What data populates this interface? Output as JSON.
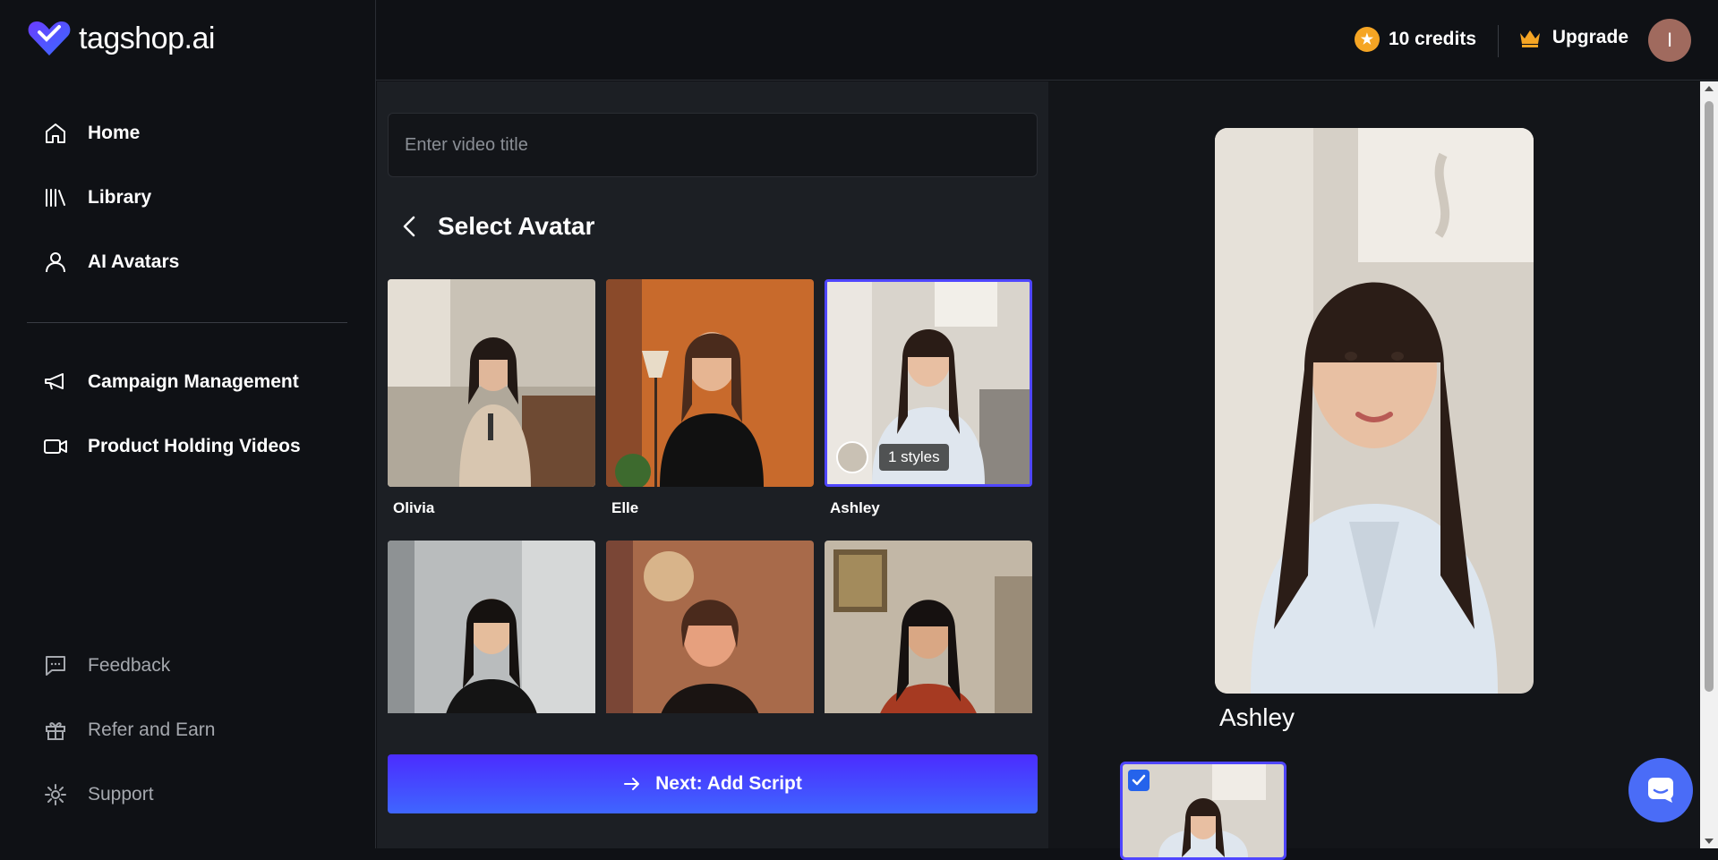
{
  "brand": {
    "name": "tagshop.ai"
  },
  "sidebar": {
    "primary": [
      {
        "label": "Home",
        "icon": "home-icon"
      },
      {
        "label": "Library",
        "icon": "library-icon"
      },
      {
        "label": "AI Avatars",
        "icon": "user-icon"
      }
    ],
    "secondary": [
      {
        "label": "Campaign Management",
        "icon": "megaphone-icon"
      },
      {
        "label": "Product Holding Videos",
        "icon": "video-icon"
      }
    ],
    "footer": [
      {
        "label": "Feedback",
        "icon": "chat-icon"
      },
      {
        "label": "Refer and Earn",
        "icon": "gift-icon"
      },
      {
        "label": "Support",
        "icon": "gear-icon"
      }
    ]
  },
  "topbar": {
    "credits_label": "10 credits",
    "upgrade_label": "Upgrade",
    "user_initial": "I"
  },
  "editor": {
    "title_placeholder": "Enter video title",
    "title_value": "",
    "section_title": "Select Avatar",
    "next_label": "Next: Add Script"
  },
  "avatars": [
    {
      "name": "Olivia",
      "selected": false
    },
    {
      "name": "Elle",
      "selected": false
    },
    {
      "name": "Ashley",
      "selected": true,
      "styles_label": "1 styles"
    },
    {
      "name": "",
      "selected": false
    },
    {
      "name": "",
      "selected": false
    },
    {
      "name": "",
      "selected": false
    }
  ],
  "preview": {
    "name": "Ashley"
  },
  "colors": {
    "accent": "#4f46ff",
    "button_from": "#4b2cff",
    "button_to": "#3f66ff",
    "coin": "#f5a524",
    "crown": "#f5a524"
  }
}
